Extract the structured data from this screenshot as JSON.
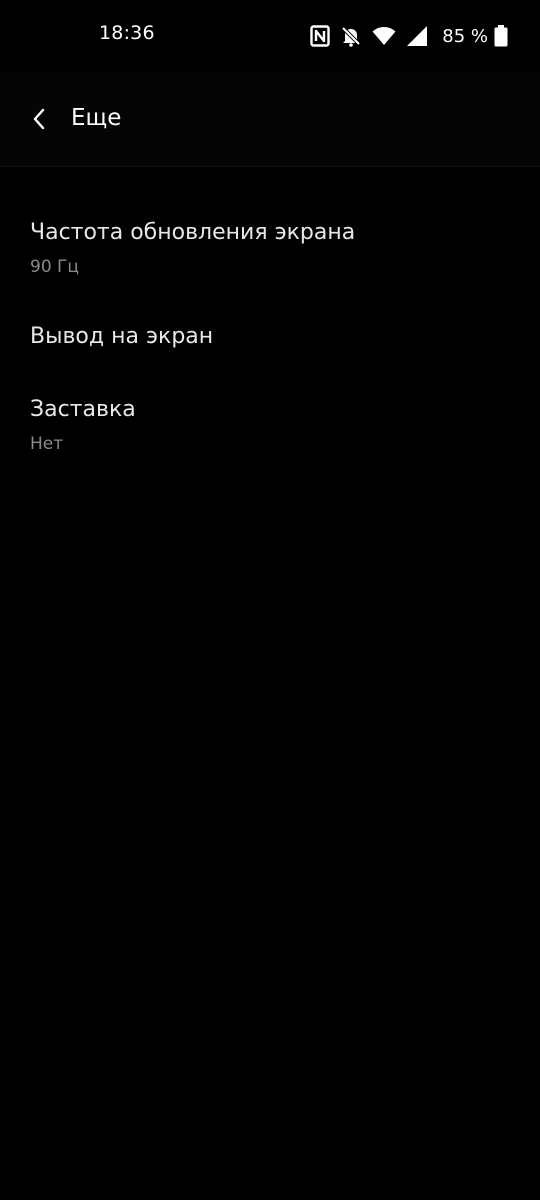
{
  "status_bar": {
    "time": "18:36",
    "battery_text": "85 %",
    "icons": [
      "nfc-icon",
      "bell-off-icon",
      "wifi-icon",
      "signal-icon",
      "battery-icon"
    ]
  },
  "app_bar": {
    "title": "Еще",
    "back_icon": "chevron-left-icon"
  },
  "settings": [
    {
      "title": "Частота обновления экрана",
      "summary": "90 Гц"
    },
    {
      "title": "Вывод на экран"
    },
    {
      "title": "Заставка",
      "summary": "Нет"
    }
  ],
  "colors": {
    "background": "#000000",
    "primary_text": "#e8e8e8",
    "secondary_text": "#8a8a8a"
  }
}
